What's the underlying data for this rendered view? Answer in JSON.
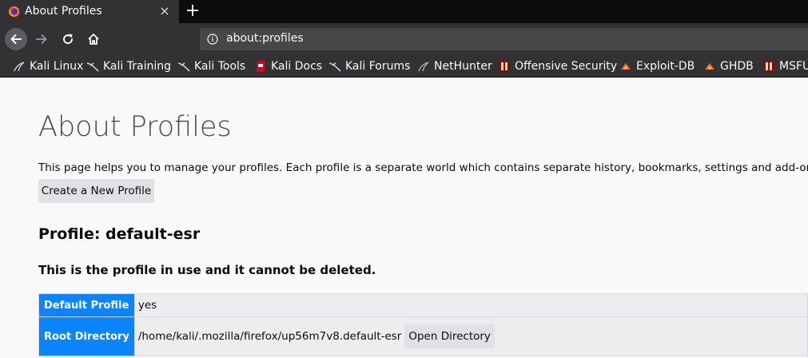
{
  "tab": {
    "title": "About Profiles",
    "favicon": "firefox-icon",
    "close_label": "×",
    "new_tab_label": "+"
  },
  "navbar": {
    "back": "back-arrow-icon",
    "forward": "forward-arrow-icon",
    "reload": "reload-icon",
    "home": "home-icon",
    "url": "about:profiles",
    "url_icon": "info-icon"
  },
  "bookmarks": [
    {
      "label": "Kali Linux",
      "icon": "kali-dragon-icon"
    },
    {
      "label": "Kali Training",
      "icon": "kali-dragon-icon"
    },
    {
      "label": "Kali Tools",
      "icon": "kali-dragon-icon"
    },
    {
      "label": "Kali Docs",
      "icon": "kali-docs-icon"
    },
    {
      "label": "Kali Forums",
      "icon": "kali-dragon-icon"
    },
    {
      "label": "NetHunter",
      "icon": "nethunter-icon"
    },
    {
      "label": "Offensive Security",
      "icon": "offsec-icon"
    },
    {
      "label": "Exploit-DB",
      "icon": "exploit-db-icon"
    },
    {
      "label": "GHDB",
      "icon": "exploit-db-icon"
    },
    {
      "label": "MSFU",
      "icon": "offsec-icon"
    }
  ],
  "page": {
    "title": "About Profiles",
    "description": "This page helps you to manage your profiles. Each profile is a separate world which contains separate history, bookmarks, settings and add-ons.",
    "create_button": "Create a New Profile"
  },
  "profile": {
    "heading": "Profile: default-esr",
    "note": "This is the profile in use and it cannot be deleted.",
    "rows": {
      "default_profile": {
        "label": "Default Profile",
        "value": "yes"
      },
      "root_directory": {
        "label": "Root Directory",
        "value": "/home/kali/.mozilla/firefox/up56m7v8.default-esr",
        "button": "Open Directory"
      }
    }
  },
  "colors": {
    "accent_blue": "#0a84ff",
    "chrome_dark": "#323234",
    "tabbar_dark": "#0c0c0d",
    "page_bg": "#f9f9fa"
  }
}
